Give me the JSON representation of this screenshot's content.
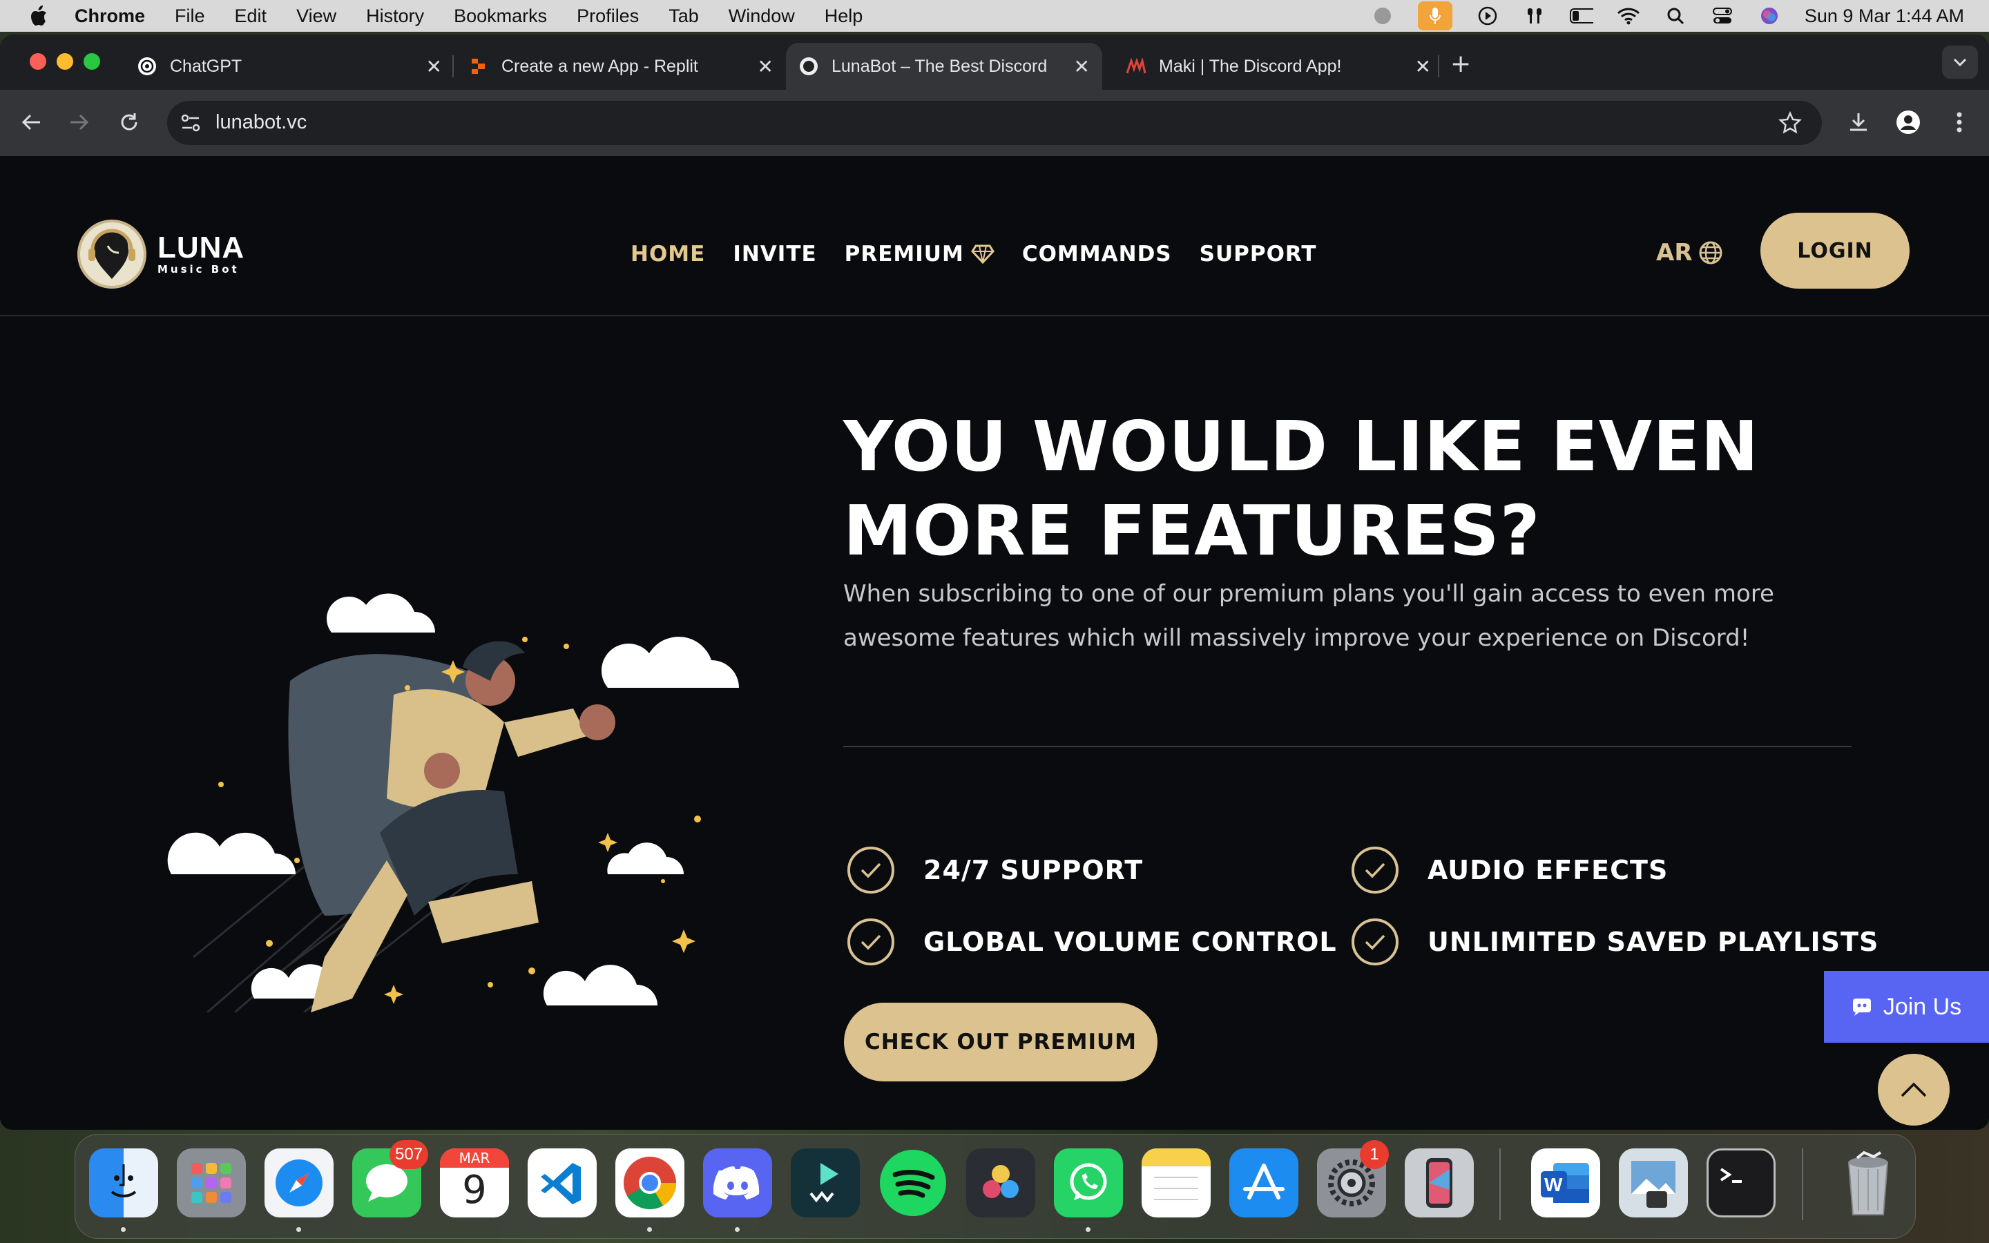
{
  "menubar": {
    "app_name": "Chrome",
    "items": [
      "File",
      "Edit",
      "View",
      "History",
      "Bookmarks",
      "Profiles",
      "Tab",
      "Window",
      "Help"
    ],
    "clock": "Sun 9 Mar  1:44 AM"
  },
  "tabs": [
    {
      "title": "ChatGPT",
      "active": false
    },
    {
      "title": "Create a new App - Replit",
      "active": false
    },
    {
      "title": "LunaBot – The Best Discord M",
      "active": true
    },
    {
      "title": "Maki | The Discord App!",
      "active": false
    }
  ],
  "toolbar": {
    "url": "lunabot.vc"
  },
  "site": {
    "logo": {
      "name": "LUNA",
      "tagline": "Music Bot"
    },
    "nav": [
      "HOME",
      "INVITE",
      "PREMIUM",
      "COMMANDS",
      "SUPPORT"
    ],
    "language": "AR",
    "login_label": "LOGIN"
  },
  "hero": {
    "headline": "YOU WOULD LIKE EVEN MORE FEATURES?",
    "subtext": "When subscribing to one of our premium plans you'll gain access to even more awesome features which will massively improve your experience on Discord!",
    "features": [
      "24/7 SUPPORT",
      "AUDIO EFFECTS",
      "GLOBAL VOLUME CONTROL",
      "UNLIMITED SAVED PLAYLISTS"
    ],
    "cta_label": "CHECK OUT PREMIUM"
  },
  "widgets": {
    "join_label": "Join Us"
  },
  "dock": {
    "messages_badge": "507",
    "calendar_month": "MAR",
    "calendar_day": "9",
    "settings_badge": "1"
  },
  "colors": {
    "accent": "#dcc28e",
    "page_bg": "#0a0b0f",
    "discord": "#5865f2"
  }
}
